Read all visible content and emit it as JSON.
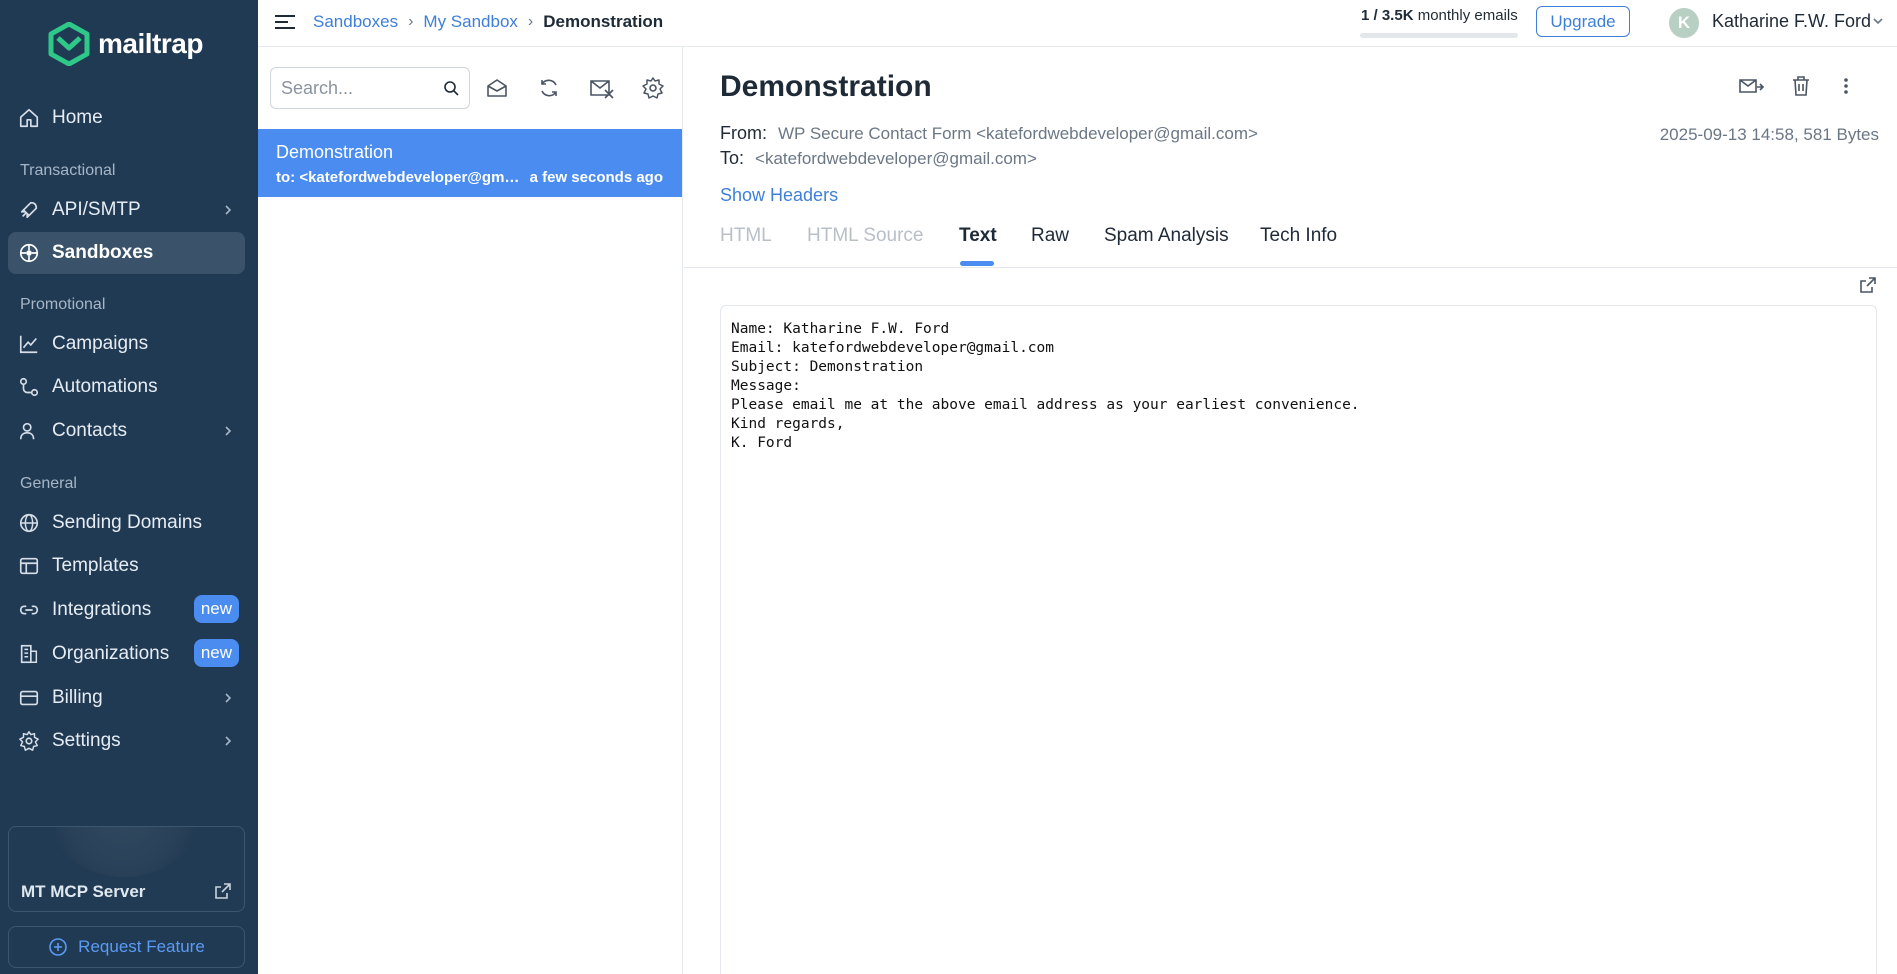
{
  "sidebar": {
    "logo_text": "mailtrap",
    "items": [
      {
        "label": "Home",
        "icon": "home-icon"
      },
      {
        "label": "API/SMTP",
        "icon": "rocket-icon"
      },
      {
        "label": "Sandboxes",
        "icon": "sandbox-icon",
        "active": true
      },
      {
        "label": "Campaigns",
        "icon": "chart-line-icon"
      },
      {
        "label": "Automations",
        "icon": "automation-icon"
      },
      {
        "label": "Contacts",
        "icon": "contacts-icon"
      },
      {
        "label": "Sending Domains",
        "icon": "globe-icon"
      },
      {
        "label": "Templates",
        "icon": "template-icon"
      },
      {
        "label": "Integrations",
        "icon": "link-icon",
        "badge": "new"
      },
      {
        "label": "Organizations",
        "icon": "building-icon",
        "badge": "new"
      },
      {
        "label": "Billing",
        "icon": "credit-card-icon"
      },
      {
        "label": "Settings",
        "icon": "gear-icon"
      }
    ],
    "sections": {
      "transactional": "Transactional",
      "promotional": "Promotional",
      "general": "General"
    },
    "mcp_label": "MT MCP Server",
    "request_feature": "Request Feature"
  },
  "topbar": {
    "breadcrumbs": [
      "Sandboxes",
      "My Sandbox",
      "Demonstration"
    ],
    "quota_used": "1 / 3.5K",
    "quota_suffix": "monthly emails",
    "quota_fraction": 0.0003,
    "upgrade_label": "Upgrade",
    "avatar_initial": "K",
    "user_name": "Katharine F.W. Ford"
  },
  "list": {
    "search_placeholder": "Search...",
    "messages": [
      {
        "subject": "Demonstration",
        "to": "to: <katefordwebdeveloper@gmail.com>",
        "time": "a few seconds ago"
      }
    ]
  },
  "message": {
    "subject": "Demonstration",
    "from_label": "From:",
    "from_value": "WP Secure Contact Form <katefordwebdeveloper@gmail.com>",
    "to_label": "To:",
    "to_value": "<katefordwebdeveloper@gmail.com>",
    "meta": "2025-09-13 14:58, 581 Bytes",
    "show_headers": "Show Headers",
    "tabs": [
      "HTML",
      "HTML Source",
      "Text",
      "Raw",
      "Spam Analysis",
      "Tech Info"
    ],
    "active_tab": "Text",
    "body_lines": [
      "Name: Katharine F.W. Ford",
      "Email: katefordwebdeveloper@gmail.com",
      "Subject: Demonstration",
      "Message:",
      "Please email me at the above email address as your earliest convenience.",
      "Kind regards,",
      "K. Ford"
    ]
  },
  "colors": {
    "sidebar_bg": "#213a53",
    "accent": "#4b8cf0",
    "link": "#3e7fd8"
  }
}
